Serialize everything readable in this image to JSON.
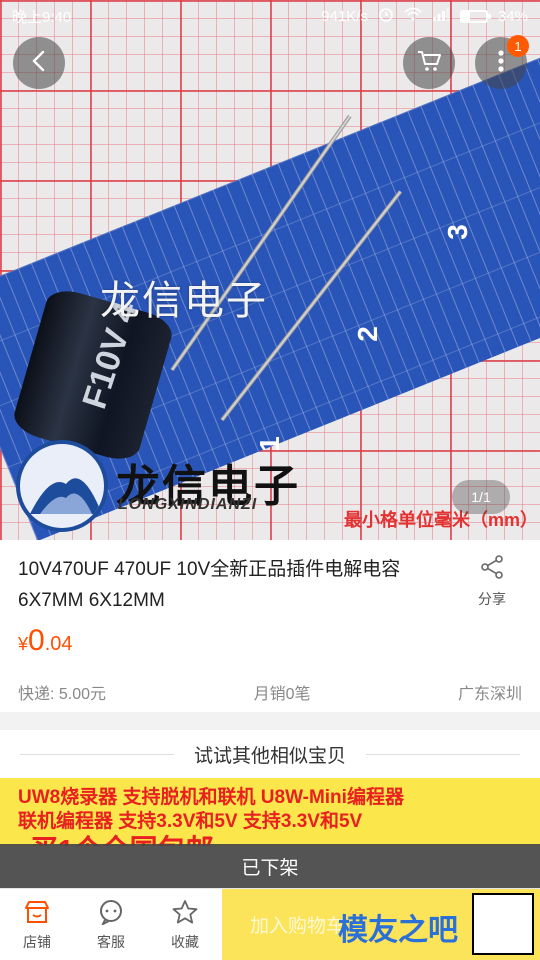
{
  "status_bar": {
    "time": "晚上9:40",
    "network_speed": "941K/s",
    "battery_percent": "34%",
    "battery_level": 0.34
  },
  "hero": {
    "watermark_center": "龙信电子",
    "logo_cn": "龙信电子",
    "logo_en": "LONGXINDIANZI",
    "unit_note": "最小格单位毫米（mm）",
    "capacitor_text": "F10V 4",
    "ruler_numbers": [
      "1",
      "2",
      "3"
    ],
    "pager": "1/1",
    "cart_badge": "1"
  },
  "product": {
    "title": "10V470UF 470UF 10V全新正品插件电解电容 6X7MM 6X12MM",
    "share_label": "分享",
    "price_currency": "¥",
    "price_int": "0",
    "price_dec": ".04",
    "shipping": "快递: 5.00元",
    "monthly_sales": "月销0笔",
    "location": "广东深圳"
  },
  "similar": {
    "heading": "试试其他相似宝贝",
    "banner_line1": "UW8烧录器  支持脱机和联机  U8W-Mini编程器",
    "banner_line2": "联机编程器    支持3.3V和5V    支持3.3V和5V",
    "banner_line3": "买1个全国包邮"
  },
  "removed_label": "已下架",
  "bottom_bar": {
    "shop": "店铺",
    "service": "客服",
    "favorite": "收藏",
    "add_to_cart": "加入购物车",
    "site_logo": "模友之吧"
  },
  "colors": {
    "accent": "#ff5000",
    "badge": "#ff5a00",
    "cart_button": "#fbe45a",
    "banner_bg": "#fbe64c"
  }
}
